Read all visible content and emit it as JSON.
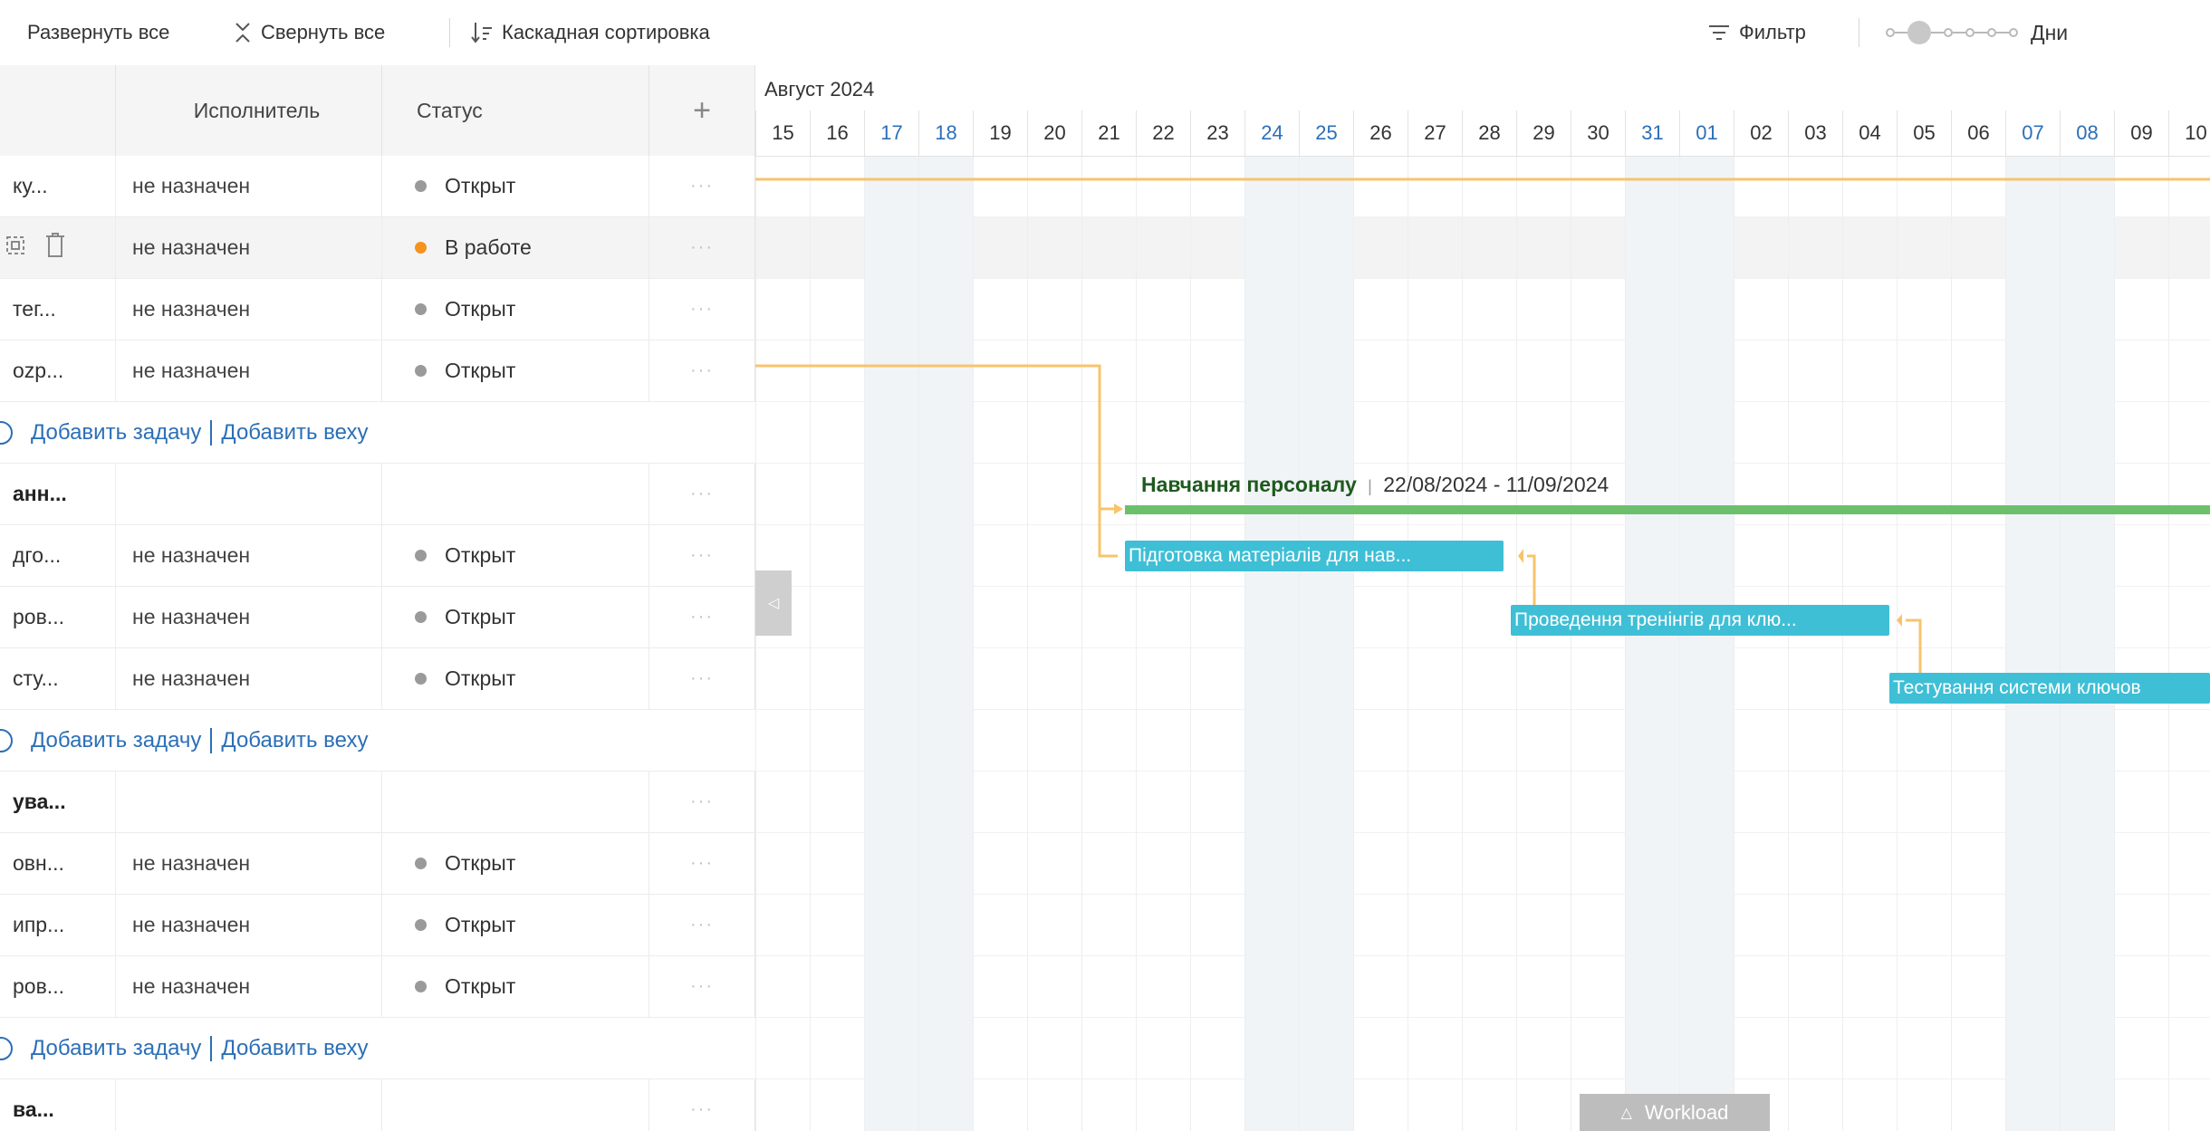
{
  "toolbar": {
    "expand_all": "Развернуть все",
    "collapse_all": "Свернуть все",
    "cascade_sort": "Каскадная сортировка",
    "filter": "Фильтр",
    "zoom_unit": "Дни"
  },
  "columns": {
    "assignee": "Исполнитель",
    "status": "Статус",
    "add": "+"
  },
  "rows": [
    {
      "type": "task",
      "name": "ку...",
      "assignee": "не назначен",
      "status": "Открыт",
      "status_color": "#9a9a9a"
    },
    {
      "type": "task",
      "name": "",
      "assignee": "не назначен",
      "status": "В работе",
      "status_color": "#f6931f",
      "hover": true
    },
    {
      "type": "task",
      "name": "тег...",
      "assignee": "не назначен",
      "status": "Открыт",
      "status_color": "#9a9a9a"
    },
    {
      "type": "task",
      "name": "ozp...",
      "assignee": "не назначен",
      "status": "Открыт",
      "status_color": "#9a9a9a"
    },
    {
      "type": "add",
      "add_task": "Добавить задачу",
      "add_milestone": "Добавить веху"
    },
    {
      "type": "group",
      "name": "анн..."
    },
    {
      "type": "task",
      "name": "дго...",
      "assignee": "не назначен",
      "status": "Открыт",
      "status_color": "#9a9a9a"
    },
    {
      "type": "task",
      "name": "ров...",
      "assignee": "не назначен",
      "status": "Открыт",
      "status_color": "#9a9a9a"
    },
    {
      "type": "task",
      "name": "сту...",
      "assignee": "не назначен",
      "status": "Открыт",
      "status_color": "#9a9a9a"
    },
    {
      "type": "add",
      "add_task": "Добавить задачу",
      "add_milestone": "Добавить веху"
    },
    {
      "type": "group",
      "name": "ува..."
    },
    {
      "type": "task",
      "name": "овн...",
      "assignee": "не назначен",
      "status": "Открыт",
      "status_color": "#9a9a9a"
    },
    {
      "type": "task",
      "name": "ипр...",
      "assignee": "не назначен",
      "status": "Открыт",
      "status_color": "#9a9a9a"
    },
    {
      "type": "task",
      "name": "ров...",
      "assignee": "не назначен",
      "status": "Открыт",
      "status_color": "#9a9a9a"
    },
    {
      "type": "add",
      "add_task": "Добавить задачу",
      "add_milestone": "Добавить веху"
    },
    {
      "type": "group",
      "name": "ва..."
    }
  ],
  "gantt": {
    "month": "Август 2024",
    "days": [
      {
        "d": "15",
        "weekend": false
      },
      {
        "d": "16",
        "weekend": false
      },
      {
        "d": "17",
        "weekend": true
      },
      {
        "d": "18",
        "weekend": true
      },
      {
        "d": "19",
        "weekend": false
      },
      {
        "d": "20",
        "weekend": false
      },
      {
        "d": "21",
        "weekend": false
      },
      {
        "d": "22",
        "weekend": false
      },
      {
        "d": "23",
        "weekend": false
      },
      {
        "d": "24",
        "weekend": true
      },
      {
        "d": "25",
        "weekend": true
      },
      {
        "d": "26",
        "weekend": false
      },
      {
        "d": "27",
        "weekend": false
      },
      {
        "d": "28",
        "weekend": false
      },
      {
        "d": "29",
        "weekend": false
      },
      {
        "d": "30",
        "weekend": false
      },
      {
        "d": "31",
        "weekend": true
      },
      {
        "d": "01",
        "weekend": true
      },
      {
        "d": "02",
        "weekend": false
      },
      {
        "d": "03",
        "weekend": false
      },
      {
        "d": "04",
        "weekend": false
      },
      {
        "d": "05",
        "weekend": false
      },
      {
        "d": "06",
        "weekend": false
      },
      {
        "d": "07",
        "weekend": true
      },
      {
        "d": "08",
        "weekend": true
      },
      {
        "d": "09",
        "weekend": false
      },
      {
        "d": "10",
        "weekend": false
      }
    ],
    "phase": {
      "name": "Навчання персоналу",
      "separator": "|",
      "dates": "22/08/2024 - 11/09/2024"
    },
    "tasks": [
      "Підготовка матеріалів для нав...",
      "Проведення тренінгів для клю...",
      "Тестування системи ключов"
    ],
    "workload": "Workload"
  },
  "colors": {
    "accent_blue": "#2c6fb7",
    "task_bar": "#3ebfd6",
    "phase_bar": "#6cc06c",
    "dependency": "#f7c46c",
    "status_open": "#9a9a9a",
    "status_in_progress": "#f6931f"
  }
}
